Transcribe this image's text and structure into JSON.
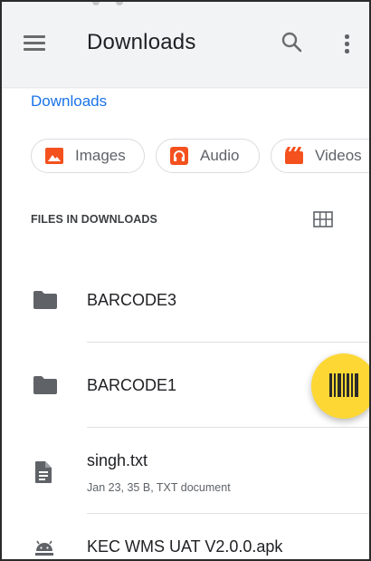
{
  "toolbar": {
    "title": "Downloads",
    "menu_icon": "hamburger-menu-icon",
    "search_icon": "search-icon",
    "more_icon": "more-vertical-icon"
  },
  "breadcrumb": {
    "current": "Downloads"
  },
  "chips": [
    {
      "label": "Images",
      "icon": "image-icon",
      "color": "#f4511e"
    },
    {
      "label": "Audio",
      "icon": "headphones-icon",
      "color": "#f4511e"
    },
    {
      "label": "Videos",
      "icon": "video-icon",
      "color": "#f4511e"
    }
  ],
  "section": {
    "title": "FILES IN DOWNLOADS",
    "view_toggle_icon": "grid-view-icon"
  },
  "files": [
    {
      "name": "BARCODE3",
      "type": "folder",
      "icon": "folder-icon"
    },
    {
      "name": "BARCODE1",
      "type": "folder",
      "icon": "folder-icon"
    },
    {
      "name": "singh.txt",
      "meta": "Jan 23, 35 B, TXT document",
      "type": "text",
      "icon": "text-file-icon"
    },
    {
      "name": "KEC WMS UAT V2.0.0.apk",
      "type": "apk",
      "icon": "android-icon"
    }
  ],
  "fab": {
    "icon": "barcode-scanner-icon",
    "color": "#fdd835"
  },
  "colors": {
    "accent": "#1a73e8",
    "toolbar_bg": "#f1f3f4",
    "icon_gray": "#5f6368"
  }
}
